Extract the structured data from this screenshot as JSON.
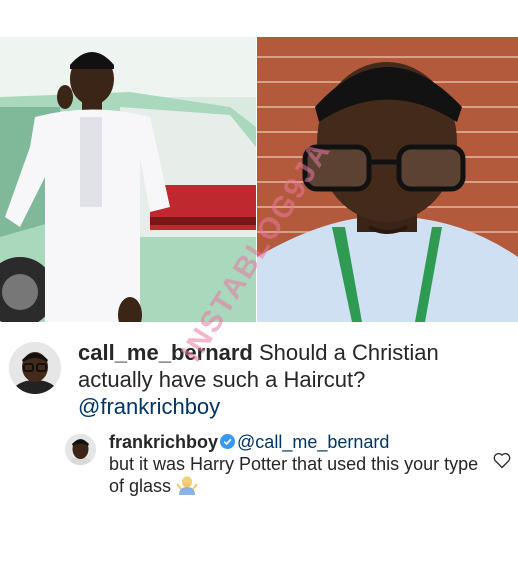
{
  "post": {
    "photos": [
      {
        "name": "man-in-white-outfit-by-car"
      },
      {
        "name": "man-with-glasses-closeup"
      }
    ]
  },
  "comment": {
    "username": "call_me_bernard",
    "text": "Should a Christian actually have such a Haircut?",
    "mention": "@frankrichboy"
  },
  "reply": {
    "username": "frankrichboy",
    "mention": "@call_me_bernard",
    "text": "but it was Harry Potter that used this your type of glass",
    "emoji": "person-shrugging"
  },
  "watermark": "INSTABLOG9JA",
  "colors": {
    "text": "#262626",
    "verified": "#3897f0",
    "watermark": "#e978a0"
  }
}
